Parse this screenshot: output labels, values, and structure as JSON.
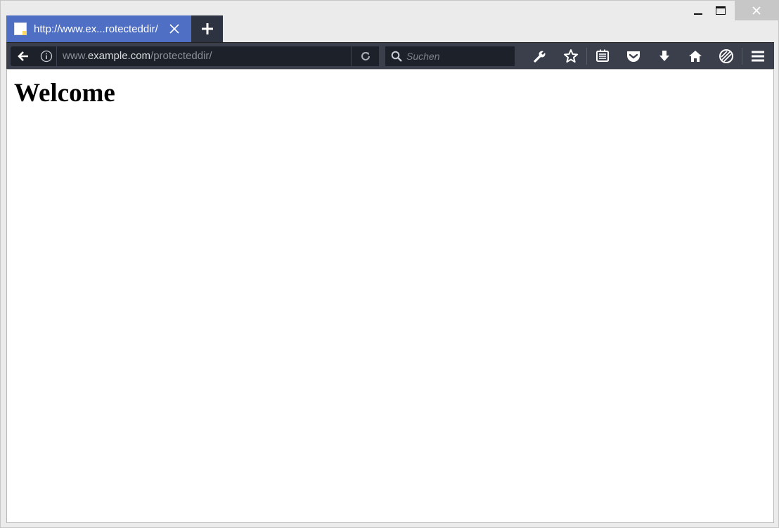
{
  "tab": {
    "title": "http://www.ex...rotecteddir/"
  },
  "urlbar": {
    "prefix": "www.",
    "host": "example.com",
    "path": "/protecteddir/"
  },
  "search": {
    "placeholder": "Suchen"
  },
  "toolbar": {
    "icons": [
      "wrench-icon",
      "star-icon",
      "reader-icon",
      "pocket-icon",
      "download-icon",
      "home-icon",
      "sync-icon",
      "menu-icon"
    ]
  },
  "page": {
    "heading": "Welcome"
  },
  "colors": {
    "tab_active": "#4e6fc4",
    "navbar": "#3a3f4b",
    "urlbar_bg": "#1d2129"
  }
}
